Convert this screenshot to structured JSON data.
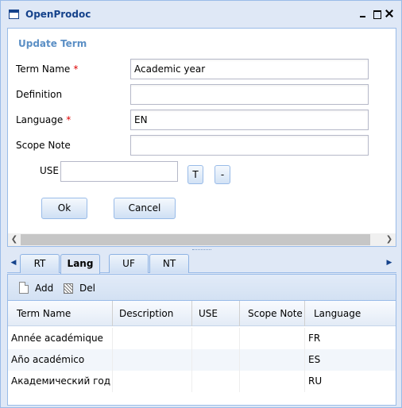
{
  "window": {
    "title": "OpenProdoc"
  },
  "form": {
    "heading": "Update Term",
    "term_name_label": "Term Name",
    "term_name_value": "Academic year",
    "definition_label": "Definition",
    "definition_value": "",
    "language_label": "Language",
    "language_value": "EN",
    "scope_note_label": "Scope Note",
    "scope_note_value": "",
    "use_label": "USE",
    "use_value": "",
    "t_button": "T",
    "clear_button": "-",
    "required_marker": "*",
    "ok_button": "Ok",
    "cancel_button": "Cancel"
  },
  "tabs": [
    {
      "label": "RT",
      "active": false
    },
    {
      "label": "Lang",
      "active": true
    },
    {
      "label": "UF",
      "active": false
    },
    {
      "label": "NT",
      "active": false
    }
  ],
  "toolbar": {
    "add_label": "Add",
    "del_label": "Del"
  },
  "grid": {
    "columns": [
      "Term Name",
      "Description",
      "USE",
      "Scope Note",
      "Language"
    ],
    "rows": [
      [
        "Année académique",
        "",
        "",
        "",
        "FR"
      ],
      [
        "Año académico",
        "",
        "",
        "",
        "ES"
      ],
      [
        "Академический год",
        "",
        "",
        "",
        "RU"
      ]
    ]
  },
  "colors": {
    "frame": "#dfe8f6",
    "border": "#99bbe8",
    "heading": "#5b8fc5",
    "required": "#dd0000"
  }
}
